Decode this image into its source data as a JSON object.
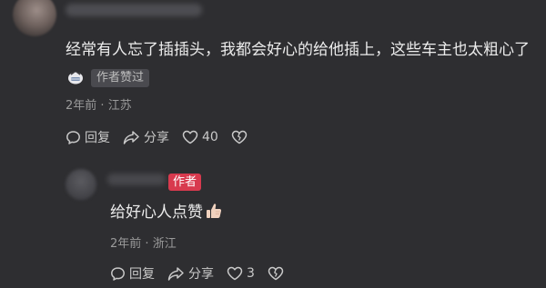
{
  "top_comment": {
    "text": "经常有人忘了插插头，我都会好心的给他插上，这些车主也太粗心了",
    "emoji_icon": "grin-face-icon",
    "liked_badge": "作者赞过",
    "time": "2年前",
    "location": "江苏",
    "actions": {
      "reply": "回复",
      "share": "分享",
      "like_count": "40"
    }
  },
  "reply": {
    "author_badge": "作者",
    "text": "给好心人点赞",
    "emoji_icon": "thumbs-up-icon",
    "time": "2年前",
    "location": "浙江",
    "actions": {
      "reply": "回复",
      "share": "分享",
      "like_count": "3"
    }
  },
  "colors": {
    "background": "#2e2e31",
    "author_badge": "#d83a4e",
    "meta_text": "#9a9a9a"
  }
}
